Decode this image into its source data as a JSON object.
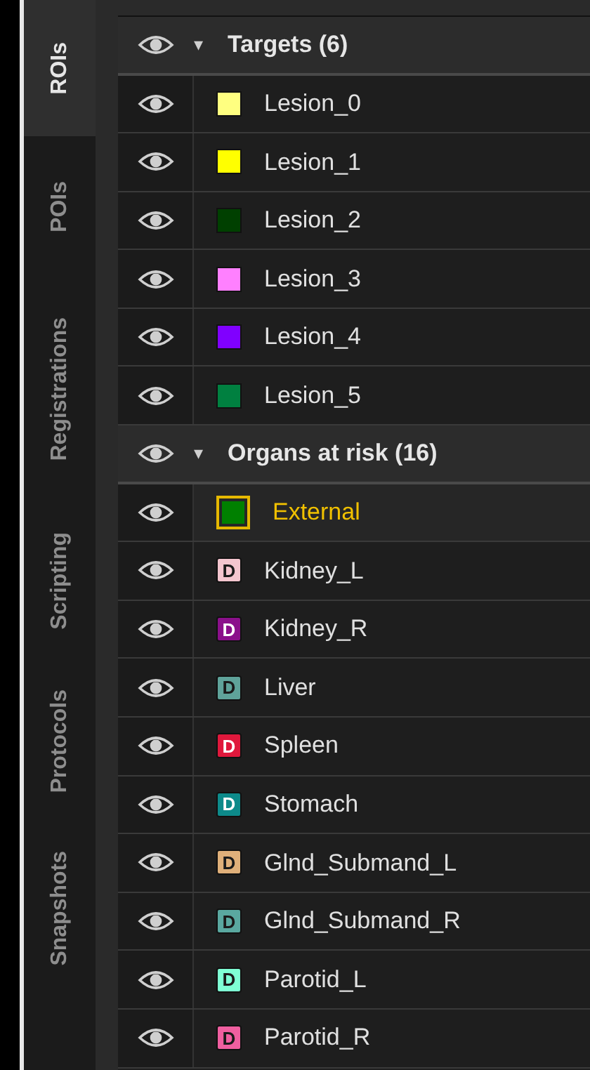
{
  "tabs": [
    {
      "label": "ROIs",
      "selected": true
    },
    {
      "label": "POIs",
      "selected": false
    },
    {
      "label": "Registrations",
      "selected": false
    },
    {
      "label": "Scripting",
      "selected": false
    },
    {
      "label": "Protocols",
      "selected": false
    },
    {
      "label": "Snapshots",
      "selected": false
    }
  ],
  "groups": [
    {
      "arrow": "▾",
      "title": "Targets (6)",
      "visible": true,
      "expanded": true,
      "items": [
        {
          "name": "Lesion_0",
          "kind": "solid",
          "color": "#ffff80",
          "visible": true,
          "selected": false
        },
        {
          "name": "Lesion_1",
          "kind": "solid",
          "color": "#ffff00",
          "visible": true,
          "selected": false
        },
        {
          "name": "Lesion_2",
          "kind": "solid",
          "color": "#004000",
          "visible": true,
          "selected": false
        },
        {
          "name": "Lesion_3",
          "kind": "solid",
          "color": "#ff80ff",
          "visible": true,
          "selected": false
        },
        {
          "name": "Lesion_4",
          "kind": "solid",
          "color": "#8000ff",
          "visible": true,
          "selected": false
        },
        {
          "name": "Lesion_5",
          "kind": "solid",
          "color": "#008040",
          "visible": true,
          "selected": false
        }
      ]
    },
    {
      "arrow": "▾",
      "title": "Organs at risk (16)",
      "visible": true,
      "expanded": true,
      "items": [
        {
          "name": "External",
          "kind": "solid",
          "color": "#008000",
          "visible": true,
          "selected": true
        },
        {
          "name": "Kidney_L",
          "kind": "letter",
          "letter": "D",
          "color": "#f4c6cf",
          "visible": true,
          "selected": false
        },
        {
          "name": "Kidney_R",
          "kind": "letter",
          "letter": "D",
          "color": "#8b108b",
          "visible": true,
          "selected": false
        },
        {
          "name": "Liver",
          "kind": "letter",
          "letter": "D",
          "color": "#5fa39a",
          "visible": true,
          "selected": false
        },
        {
          "name": "Spleen",
          "kind": "letter",
          "letter": "D",
          "color": "#e0183c",
          "visible": true,
          "selected": false
        },
        {
          "name": "Stomach",
          "kind": "letter",
          "letter": "D",
          "color": "#0d8a8a",
          "visible": true,
          "selected": false
        },
        {
          "name": "Glnd_Submand_L",
          "kind": "letter",
          "letter": "D",
          "color": "#e0b07a",
          "visible": true,
          "selected": false
        },
        {
          "name": "Glnd_Submand_R",
          "kind": "letter",
          "letter": "D",
          "color": "#5aa8a0",
          "visible": true,
          "selected": false
        },
        {
          "name": "Parotid_L",
          "kind": "letter",
          "letter": "D",
          "color": "#7fffd4",
          "visible": true,
          "selected": false
        },
        {
          "name": "Parotid_R",
          "kind": "letter",
          "letter": "D",
          "color": "#f05fa0",
          "visible": true,
          "selected": false
        }
      ]
    }
  ]
}
